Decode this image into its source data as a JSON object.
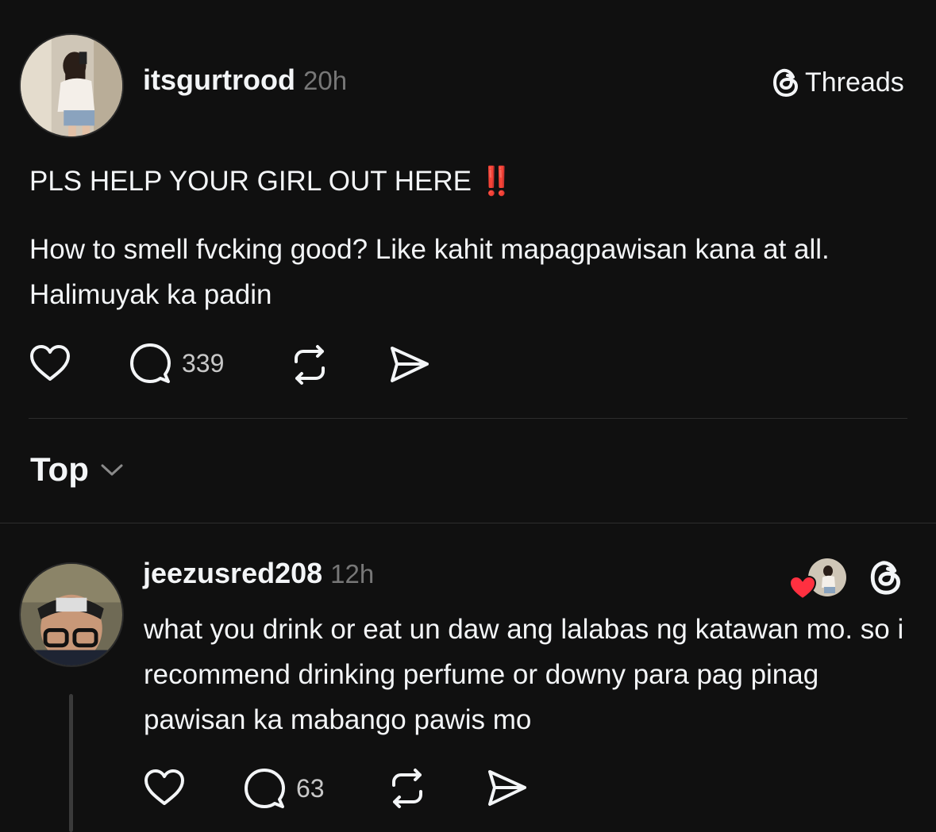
{
  "post": {
    "username": "itsgurtrood",
    "time": "20h",
    "brand": "Threads",
    "headline": "PLS HELP YOUR GIRL OUT HERE",
    "headline_emoji": "‼️",
    "body": "How to smell fvcking good? Like kahit mapagpawisan kana at all. Halimuyak ka padin",
    "reply_count": "339"
  },
  "sort": {
    "label": "Top"
  },
  "reply": {
    "username": "jeezusred208",
    "time": "12h",
    "text": "what you drink or eat un daw ang lalabas ng katawan mo. so i recommend drinking perfume or downy para pag pinag pawisan ka mabango pawis mo",
    "reply_count": "63"
  },
  "colors": {
    "background": "#101010",
    "text": "#f3f5f7",
    "muted": "#777777",
    "like_red": "#ff3040"
  }
}
